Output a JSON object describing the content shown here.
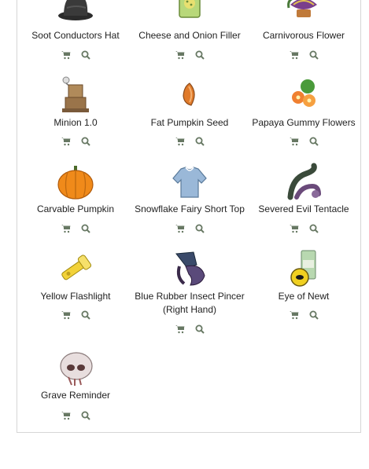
{
  "accent_icon_color": "#677863",
  "items": [
    {
      "name": "Soot Conductors Hat",
      "icon": "black-hat-icon"
    },
    {
      "name": "Cheese and Onion Filler",
      "icon": "snack-jar-icon"
    },
    {
      "name": "Carnivorous Flower",
      "icon": "carnivorous-flower-icon"
    },
    {
      "name": "Minion 1.0",
      "icon": "cardboard-robot-icon"
    },
    {
      "name": "Fat Pumpkin Seed",
      "icon": "seed-icon"
    },
    {
      "name": "Papaya Gummy Flowers",
      "icon": "gummy-flowers-icon"
    },
    {
      "name": "Carvable Pumpkin",
      "icon": "pumpkin-icon"
    },
    {
      "name": "Snowflake Fairy Short Top",
      "icon": "shirt-icon"
    },
    {
      "name": "Severed Evil Tentacle",
      "icon": "tentacle-icon"
    },
    {
      "name": "Yellow Flashlight",
      "icon": "flashlight-icon"
    },
    {
      "name": "Blue Rubber Insect Pincer (Right Hand)",
      "icon": "insect-pincer-icon"
    },
    {
      "name": "Eye of Newt",
      "icon": "eye-of-newt-icon"
    },
    {
      "name": "Grave Reminder",
      "icon": "skull-icon"
    }
  ],
  "actions": {
    "shop": "shopping-cart-icon",
    "search": "search-icon"
  }
}
